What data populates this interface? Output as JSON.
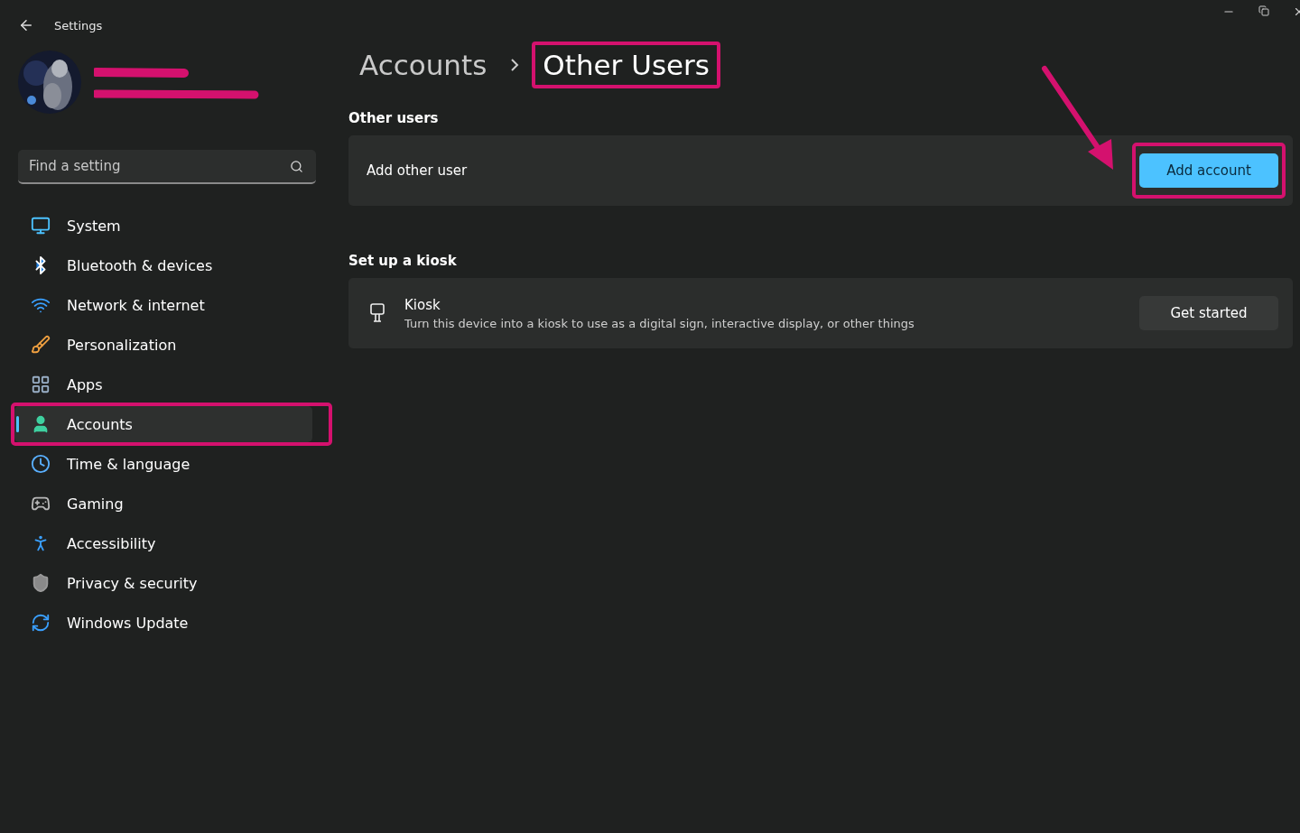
{
  "window": {
    "title": "Settings"
  },
  "search": {
    "placeholder": "Find a setting"
  },
  "sidebar": {
    "items": [
      {
        "label": "System",
        "selected": false,
        "highlighted": false
      },
      {
        "label": "Bluetooth & devices",
        "selected": false,
        "highlighted": false
      },
      {
        "label": "Network & internet",
        "selected": false,
        "highlighted": false
      },
      {
        "label": "Personalization",
        "selected": false,
        "highlighted": false
      },
      {
        "label": "Apps",
        "selected": false,
        "highlighted": false
      },
      {
        "label": "Accounts",
        "selected": true,
        "highlighted": true
      },
      {
        "label": "Time & language",
        "selected": false,
        "highlighted": false
      },
      {
        "label": "Gaming",
        "selected": false,
        "highlighted": false
      },
      {
        "label": "Accessibility",
        "selected": false,
        "highlighted": false
      },
      {
        "label": "Privacy & security",
        "selected": false,
        "highlighted": false
      },
      {
        "label": "Windows Update",
        "selected": false,
        "highlighted": false
      }
    ]
  },
  "breadcrumb": [
    {
      "label": "Accounts",
      "highlighted": false
    },
    {
      "label": "Other Users",
      "highlighted": true
    }
  ],
  "sections": [
    {
      "title": "Other users",
      "card": {
        "label": "Add other user",
        "button": {
          "label": "Add account",
          "primary": true,
          "highlighted": true
        }
      }
    },
    {
      "title": "Set up a kiosk",
      "card": {
        "label": "Kiosk",
        "description": "Turn this device into a kiosk to use as a digital sign, interactive display, or other things",
        "button": {
          "label": "Get started",
          "primary": false,
          "highlighted": false
        }
      }
    }
  ]
}
